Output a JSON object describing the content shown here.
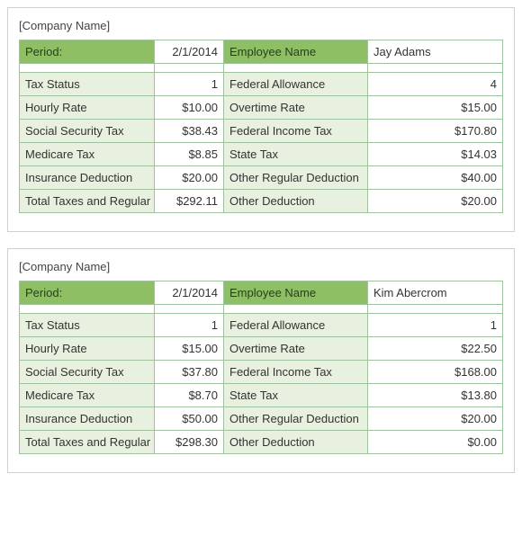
{
  "cards": [
    {
      "company": "[Company Name]",
      "header": {
        "periodLabel": "Period:",
        "periodValue": "2/1/2014",
        "empLabel": "Employee Name",
        "empValue": "Jay Adams"
      },
      "rows": [
        {
          "l1": "Tax Status",
          "v1": "1",
          "l2": "Federal Allowance",
          "v2": "4"
        },
        {
          "l1": "Hourly Rate",
          "v1": "$10.00",
          "l2": "Overtime Rate",
          "v2": "$15.00"
        },
        {
          "l1": "Social Security Tax",
          "v1": "$38.43",
          "l2": "Federal Income Tax",
          "v2": "$170.80"
        },
        {
          "l1": "Medicare Tax",
          "v1": "$8.85",
          "l2": "State Tax",
          "v2": "$14.03"
        },
        {
          "l1": "Insurance Deduction",
          "v1": "$20.00",
          "l2": "Other Regular Deduction",
          "v2": "$40.00"
        },
        {
          "l1": "Total Taxes and Regular",
          "v1": "$292.11",
          "l2": "Other Deduction",
          "v2": "$20.00"
        }
      ]
    },
    {
      "company": "[Company Name]",
      "header": {
        "periodLabel": "Period:",
        "periodValue": "2/1/2014",
        "empLabel": "Employee Name",
        "empValue": "Kim Abercrom"
      },
      "rows": [
        {
          "l1": "Tax Status",
          "v1": "1",
          "l2": "Federal Allowance",
          "v2": "1"
        },
        {
          "l1": "Hourly Rate",
          "v1": "$15.00",
          "l2": "Overtime Rate",
          "v2": "$22.50"
        },
        {
          "l1": "Social Security Tax",
          "v1": "$37.80",
          "l2": "Federal Income Tax",
          "v2": "$168.00"
        },
        {
          "l1": "Medicare Tax",
          "v1": "$8.70",
          "l2": "State Tax",
          "v2": "$13.80"
        },
        {
          "l1": "Insurance Deduction",
          "v1": "$50.00",
          "l2": "Other Regular Deduction",
          "v2": "$20.00"
        },
        {
          "l1": "Total Taxes and Regular",
          "v1": "$298.30",
          "l2": "Other Deduction",
          "v2": "$0.00"
        }
      ]
    }
  ]
}
